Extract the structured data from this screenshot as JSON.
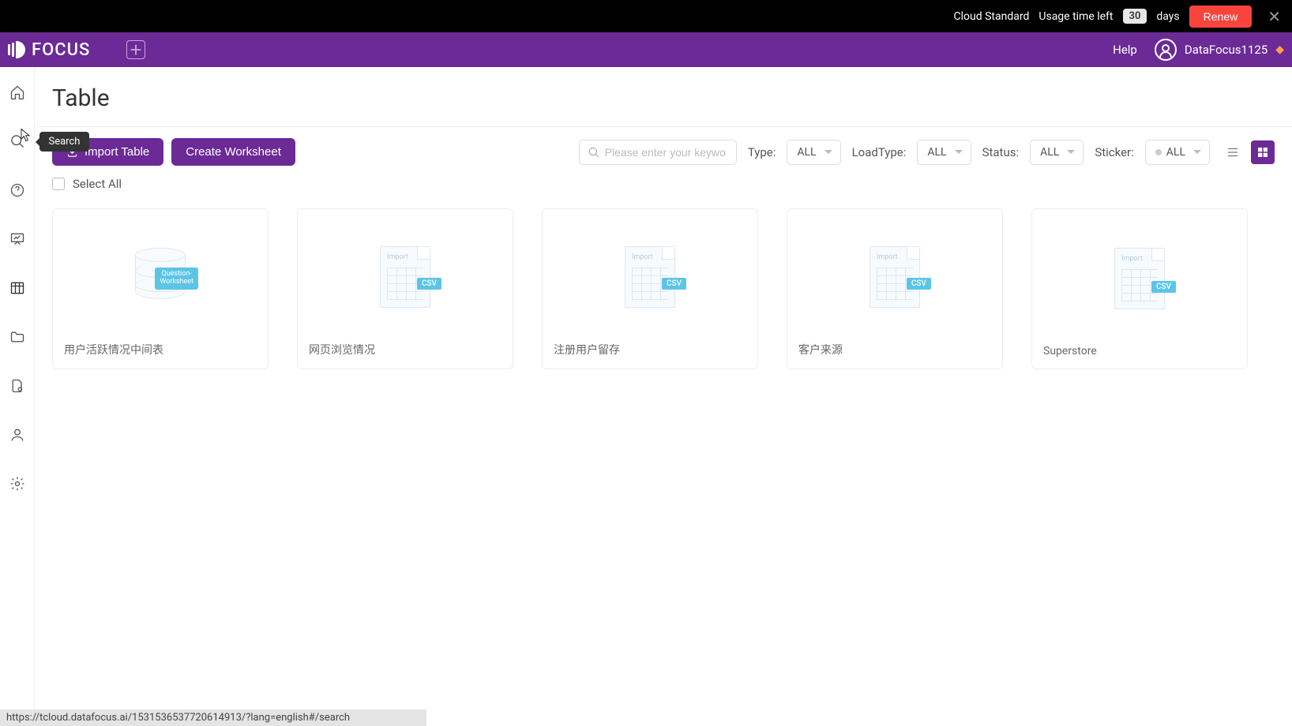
{
  "topbar": {
    "plan": "Cloud Standard",
    "usage_label": "Usage time left",
    "days_count": "30",
    "days_unit": "days",
    "renew": "Renew"
  },
  "header": {
    "brand": "FOCUS",
    "help": "Help",
    "username": "DataFocus1125"
  },
  "sidebar": {
    "tooltip": "Search"
  },
  "page": {
    "title": "Table"
  },
  "toolbar": {
    "import": "Import Table",
    "create": "Create Worksheet",
    "search_placeholder": "Please enter your keywo",
    "type_label": "Type:",
    "type_value": "ALL",
    "loadtype_label": "LoadType:",
    "loadtype_value": "ALL",
    "status_label": "Status:",
    "status_value": "ALL",
    "sticker_label": "Sticker:",
    "sticker_value": "ALL"
  },
  "selectall": {
    "label": "Select All"
  },
  "cards": [
    {
      "type": "worksheet",
      "label": "用户活跃情况中间表",
      "badge": "Question-\nWorksheet"
    },
    {
      "type": "csv",
      "label": "网页浏览情况",
      "badge": "CSV",
      "import": "Import"
    },
    {
      "type": "csv",
      "label": "注册用户留存",
      "badge": "CSV",
      "import": "Import"
    },
    {
      "type": "csv",
      "label": "客户来源",
      "badge": "CSV",
      "import": "Import"
    },
    {
      "type": "csv",
      "label": "Superstore",
      "badge": "CSV",
      "import": "Import"
    }
  ],
  "statusbar": {
    "url": "https://tcloud.datafocus.ai/1531536537720614913/?lang=english#/search"
  }
}
